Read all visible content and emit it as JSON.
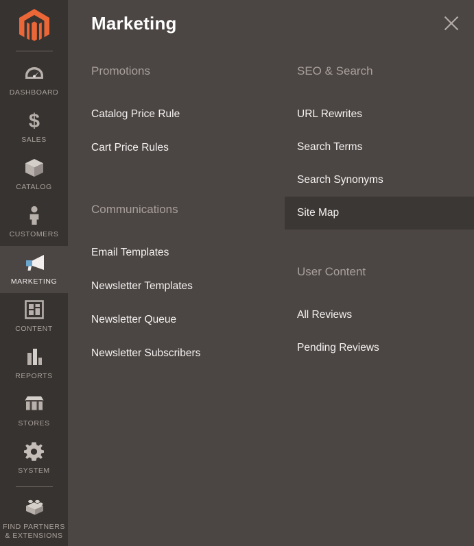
{
  "colors": {
    "sidebar_bg": "#373330",
    "panel_bg": "#4b4543",
    "highlight_bg": "#3b3734",
    "accent_orange": "#ec6737",
    "muted_text": "#a8a09b",
    "primary_text": "#f5f3f2"
  },
  "sidebar": {
    "logo_name": "magento-logo",
    "items": [
      {
        "label": "DASHBOARD",
        "icon": "gauge-icon",
        "active": false
      },
      {
        "label": "SALES",
        "icon": "dollar-icon",
        "active": false
      },
      {
        "label": "CATALOG",
        "icon": "box-icon",
        "active": false
      },
      {
        "label": "CUSTOMERS",
        "icon": "person-icon",
        "active": false
      },
      {
        "label": "MARKETING",
        "icon": "megaphone-icon",
        "active": true
      },
      {
        "label": "CONTENT",
        "icon": "layout-icon",
        "active": false
      },
      {
        "label": "REPORTS",
        "icon": "bar-chart-icon",
        "active": false
      },
      {
        "label": "STORES",
        "icon": "storefront-icon",
        "active": false
      },
      {
        "label": "SYSTEM",
        "icon": "gear-icon",
        "active": false
      },
      {
        "label": "FIND PARTNERS\n& EXTENSIONS",
        "icon": "lego-brick-icon",
        "active": false
      }
    ]
  },
  "panel": {
    "title": "Marketing",
    "close_icon": "close-icon",
    "left_column": [
      {
        "title": "Promotions",
        "links": [
          {
            "label": "Catalog Price Rule",
            "current": false
          },
          {
            "label": "Cart Price Rules",
            "current": false
          }
        ]
      },
      {
        "title": "Communications",
        "links": [
          {
            "label": "Email Templates",
            "current": false
          },
          {
            "label": "Newsletter Templates",
            "current": false
          },
          {
            "label": "Newsletter Queue",
            "current": false
          },
          {
            "label": "Newsletter Subscribers",
            "current": false
          }
        ]
      }
    ],
    "right_column": [
      {
        "title": "SEO & Search",
        "links": [
          {
            "label": "URL Rewrites",
            "current": false
          },
          {
            "label": "Search Terms",
            "current": false
          },
          {
            "label": "Search Synonyms",
            "current": false
          },
          {
            "label": "Site Map",
            "current": true
          }
        ]
      },
      {
        "title": "User Content",
        "links": [
          {
            "label": "All Reviews",
            "current": false
          },
          {
            "label": "Pending Reviews",
            "current": false
          }
        ]
      }
    ]
  }
}
